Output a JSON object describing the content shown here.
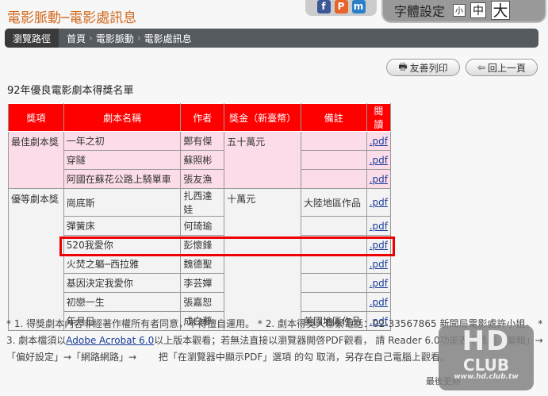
{
  "header": {
    "title": "電影脈動─電影處訊息",
    "font_setting_label": "字體設定",
    "font_sizes": [
      "小",
      "中",
      "大"
    ],
    "share": [
      "f",
      "P",
      "m"
    ]
  },
  "breadcrumb": {
    "label": "瀏覽路徑",
    "items": [
      "首頁",
      "電影脈動",
      "電影處訊息"
    ]
  },
  "buttons": {
    "print": "友善列印",
    "back": "回上一頁"
  },
  "page_title": "92年優良電影劇本得獎名單",
  "table": {
    "headers": [
      "獎項",
      "劇本名稱",
      "作者",
      "獎金（新臺幣）",
      "備註",
      "閱讀"
    ],
    "groups": [
      {
        "award": "最佳劇本獎",
        "prize": "五十萬元",
        "rows": [
          {
            "title": "一年之初",
            "author": "鄭有傑",
            "note": "",
            "link": ".pdf"
          },
          {
            "title": "穿隧",
            "author": "蘇照彬",
            "note": "",
            "link": ".pdf"
          },
          {
            "title": "阿國在蘇花公路上騎單車",
            "author": "張友漁",
            "note": "",
            "link": ".pdf"
          }
        ]
      },
      {
        "award": "優等劇本獎",
        "prize": "十萬元",
        "rows": [
          {
            "title": "崗底斯",
            "author": "扎西達娃",
            "note": "大陸地區作品",
            "link": ".pdf"
          },
          {
            "title": "彈簧床",
            "author": "何琦瑜",
            "note": "",
            "link": ".pdf"
          },
          {
            "title": "520我愛你",
            "author": "彭懷鋒",
            "note": "",
            "link": ".pdf"
          },
          {
            "title": "火焚之軀─西拉雅",
            "author": "魏德聖",
            "note": "",
            "link": ".pdf"
          },
          {
            "title": "基因決定我愛你",
            "author": "李芸嬋",
            "note": "",
            "link": ".pdf"
          },
          {
            "title": "初戀一生",
            "author": "張嘉恕",
            "note": "",
            "link": ".pdf"
          },
          {
            "title": "年月日",
            "author": "成白夢",
            "note": "美國地區作品",
            "link": ".pdf"
          }
        ]
      }
    ]
  },
  "notes": {
    "part1": "* 1. 得獎劇本內容非經著作權所有者同意，不得擅自運用。 * 2. 劇本得獎人聯繫電話：02-33567865 新聞局電影處許小姐。 * 3. 劇本檔須以",
    "link": "Adobe Acrobat 6.0",
    "part2": "以上版本觀看；若無法直接以瀏覽器開啓PDF觀看， 請 Reader 6.0功能表中找到「編輯」→「偏好設定」→「網路網路」→ 　　把「在瀏覽器中顯示PDF」選項 的勾 取消，另存在自己電腦上觀看。"
  },
  "updated": "最後更新",
  "watermark": {
    "text": "HD CLUB",
    "url": "www.hd.club.tw"
  },
  "colors": {
    "title": "#d2691e",
    "header_bg": "#ff0000",
    "pink": "#fcdce8",
    "highlight": "#ee0000"
  }
}
